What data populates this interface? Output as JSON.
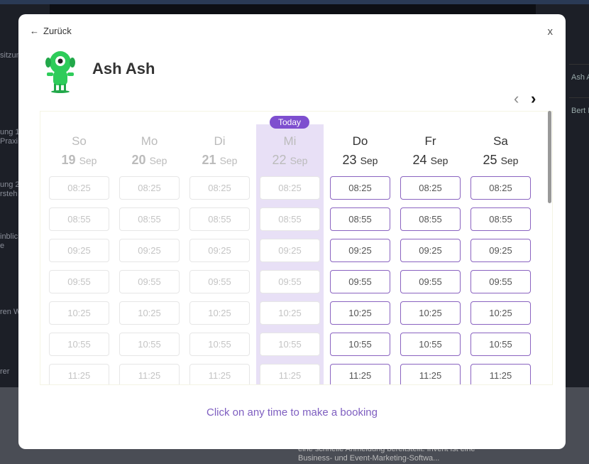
{
  "background": {
    "left_texts": [
      "sitzun",
      "ung 1",
      "Praxi",
      "ung 2",
      "rsteh",
      "inblic",
      "e",
      "ren W",
      "rer"
    ],
    "right_texts": [
      "Ash A",
      "Bert I"
    ],
    "bottom_texts": [
      "eine schnelle Anmeldung bereitstellt. Invent ist eine",
      "Business- und Event-Marketing-Softwa..."
    ]
  },
  "modal": {
    "back_label": "Zurück",
    "close_label": "x",
    "host_name": "Ash Ash",
    "prev_label": "‹",
    "next_label": "›",
    "today_label": "Today",
    "hint": "Click on any time to make a booking",
    "accent": "#7e4fcf",
    "days": [
      {
        "dow": "So",
        "day": "19",
        "month": "Sep",
        "state": "past"
      },
      {
        "dow": "Mo",
        "day": "20",
        "month": "Sep",
        "state": "past"
      },
      {
        "dow": "Di",
        "day": "21",
        "month": "Sep",
        "state": "past"
      },
      {
        "dow": "Mi",
        "day": "22",
        "month": "Sep",
        "state": "today"
      },
      {
        "dow": "Do",
        "day": "23",
        "month": "Sep",
        "state": "future"
      },
      {
        "dow": "Fr",
        "day": "24",
        "month": "Sep",
        "state": "future"
      },
      {
        "dow": "Sa",
        "day": "25",
        "month": "Sep",
        "state": "future"
      }
    ],
    "slots": [
      "08:25",
      "08:55",
      "09:25",
      "09:55",
      "10:25",
      "10:55",
      "11:25"
    ]
  }
}
